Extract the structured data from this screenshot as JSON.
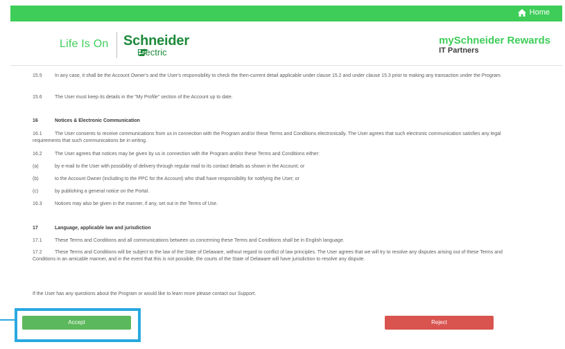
{
  "topbar": {
    "home_label": "Home",
    "home_icon": "home-icon"
  },
  "header": {
    "life_is_on": "Life Is On",
    "brand_name": "Schneider",
    "brand_sub": "Electric",
    "rewards_title": "mySchneider Rewards",
    "rewards_sub": "IT Partners"
  },
  "terms": [
    {
      "num": "15.5",
      "text": "In any case, it shall be the Account Owner's and the User's responsibility to check the then-current detail applicable under clause 15.2 and under clause 15.3 prior to making any transaction under the Program."
    },
    {
      "num": "15.6",
      "text": "The User must keep its details in the \"My Profile\" section of the Account up to date."
    },
    {
      "num": "16",
      "text": "Notices & Electronic Communication",
      "heading": true
    },
    {
      "num": "16.1",
      "text": "The User consents to receive communications from us in connection with the Program and/or these Terms and Conditions electronically. The User agrees that such electronic communication satisfies any legal requirements that such communications be in writing."
    },
    {
      "num": "16.2",
      "text": "The User agrees that notices may be given by us in connection with the Program and/or these Terms and Conditions either:"
    },
    {
      "num": "(a)",
      "text": "by e-mail to the User with possibility of delivery through regular mail to its contact details as shown in the Account; or"
    },
    {
      "num": "(b)",
      "text": "to the Account Owner (including to the PPC for the Account) who shall have responsibility for notifying the User; or"
    },
    {
      "num": "(c)",
      "text": "by publishing a general notice on the Portal."
    },
    {
      "num": "16.3",
      "text": "Notices may also be given in the manner, if any, set out in the Terms of Use."
    },
    {
      "num": "17",
      "text": "Language, applicable law and jurisdiction",
      "heading": true
    },
    {
      "num": "17.1",
      "text": "These Terms and Conditions and all communications between us concerning these Terms and Conditions shall be in English language."
    },
    {
      "num": "17.2",
      "text": "These Terms and Conditions will be subject to the law of the State of Delaware, without regard to conflict of law principles. The User agrees that we will try to resolve any disputes arising out of these Terms and Conditions in an amicable manner, and in the event that this is not possible, the courts of the State of Delaware will have jurisdiction to resolve any dispute."
    },
    {
      "num": "",
      "text": "If the User has any questions about the Program or would like to learn more please contact our Support."
    }
  ],
  "actions": {
    "accept_label": "Accept",
    "reject_label": "Reject"
  },
  "colors": {
    "brand_green": "#3dcd58",
    "accept": "#5cb85c",
    "reject": "#d9534f",
    "highlight": "#29a8e0"
  }
}
